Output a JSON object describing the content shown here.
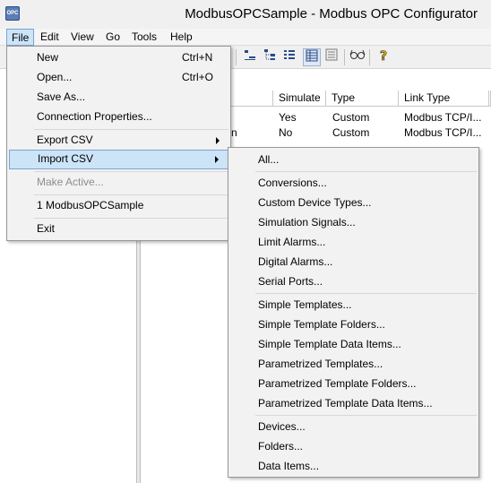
{
  "window": {
    "title": "ModbusOPCSample - Modbus OPC Configurator",
    "icon_label": "OPC"
  },
  "menubar": [
    "File",
    "Edit",
    "View",
    "Go",
    "Tools",
    "Help"
  ],
  "file_menu": {
    "new": {
      "label": "New",
      "shortcut": "Ctrl+N"
    },
    "open": {
      "label": "Open...",
      "shortcut": "Ctrl+O"
    },
    "save_as": {
      "label": "Save As..."
    },
    "connection_properties": {
      "label": "Connection Properties..."
    },
    "export_csv": {
      "label": "Export CSV"
    },
    "import_csv": {
      "label": "Import CSV"
    },
    "make_active": {
      "label": "Make Active..."
    },
    "recent_1": {
      "label": "1 ModbusOPCSample"
    },
    "exit": {
      "label": "Exit"
    }
  },
  "import_submenu": {
    "group1": [
      "All..."
    ],
    "group2": [
      "Conversions...",
      "Custom Device Types...",
      "Simulation Signals...",
      "Limit Alarms...",
      "Digital Alarms...",
      "Serial Ports..."
    ],
    "group3": [
      "Simple Templates...",
      "Simple Template Folders...",
      "Simple Template Data Items...",
      "Parametrized Templates...",
      "Parametrized Template Folders...",
      "Parametrized Template Data Items..."
    ],
    "group4": [
      "Devices...",
      "Folders...",
      "Data Items..."
    ]
  },
  "table": {
    "columns": [
      "Simulate",
      "Type",
      "Link Type"
    ],
    "rows": [
      {
        "name_fragment": "",
        "simulate": "Yes",
        "type": "Custom",
        "link_type": "Modbus TCP/I..."
      },
      {
        "name_fragment": "n",
        "simulate": "No",
        "type": "Custom",
        "link_type": "Modbus TCP/I..."
      }
    ]
  },
  "toolbar": {
    "icons": [
      "list-icon",
      "tree-icon",
      "details-icon",
      "grid-view-icon",
      "report-view-icon",
      "glasses-icon",
      "help-icon"
    ]
  },
  "colors": {
    "highlight": "#cce4f7",
    "highlight_border": "#7da2ce",
    "menu_bg": "#f2f2f2"
  }
}
